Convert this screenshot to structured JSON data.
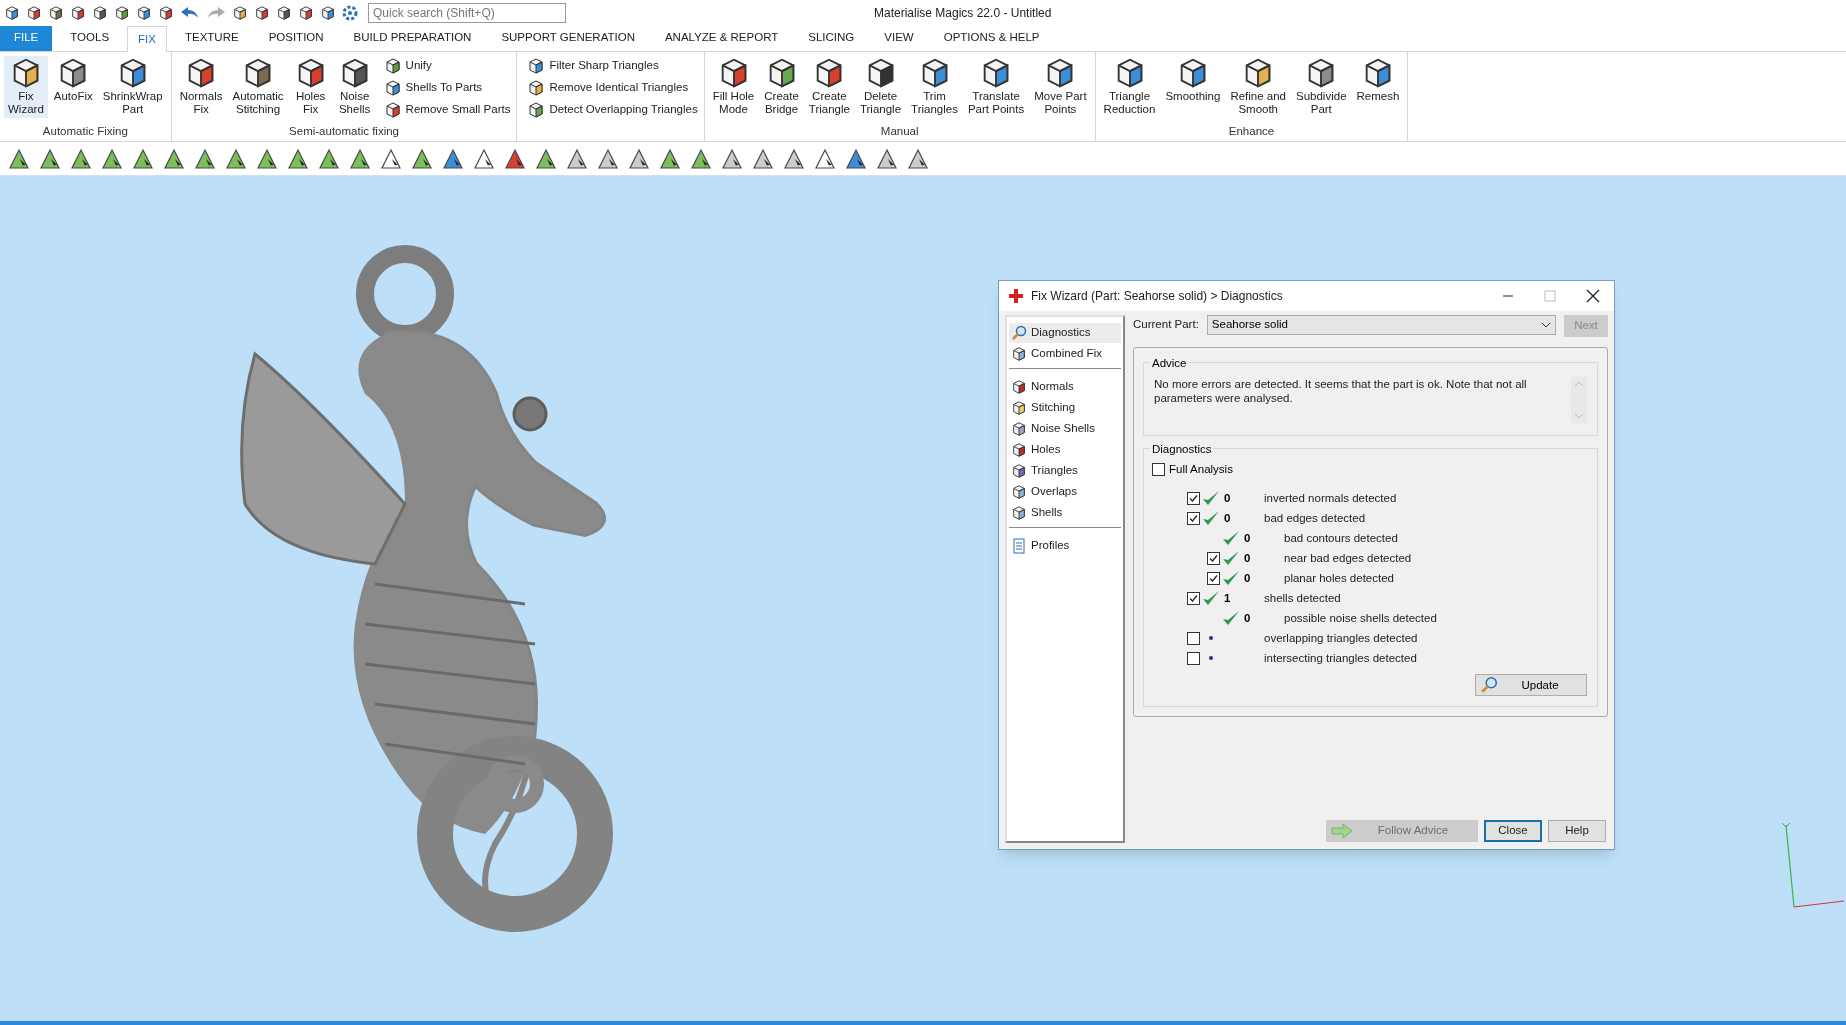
{
  "window": {
    "title": "Materialise Magics 22.0 - Untitled"
  },
  "search": {
    "placeholder": "Quick search (Shift+Q)"
  },
  "tabs": [
    {
      "label": "FILE",
      "kind": "file",
      "selected": false
    },
    {
      "label": "TOOLS",
      "kind": "tab",
      "selected": false
    },
    {
      "label": "FIX",
      "kind": "tab",
      "selected": true
    },
    {
      "label": "TEXTURE",
      "kind": "tab",
      "selected": false
    },
    {
      "label": "POSITION",
      "kind": "tab",
      "selected": false
    },
    {
      "label": "BUILD PREPARATION",
      "kind": "tab",
      "selected": false
    },
    {
      "label": "SUPPORT GENERATION",
      "kind": "tab",
      "selected": false
    },
    {
      "label": "ANALYZE & REPORT",
      "kind": "tab",
      "selected": false
    },
    {
      "label": "SLICING",
      "kind": "tab",
      "selected": false
    },
    {
      "label": "VIEW",
      "kind": "tab",
      "selected": false
    },
    {
      "label": "OPTIONS & HELP",
      "kind": "tab",
      "selected": false
    }
  ],
  "ribbon": {
    "groups": [
      {
        "label": "Automatic Fixing",
        "tools": [
          {
            "label": "Fix\nWizard",
            "kind": "large",
            "selected": true
          },
          {
            "label": "AutoFix",
            "kind": "large",
            "selected": false
          },
          {
            "label": "ShrinkWrap\nPart",
            "kind": "large",
            "selected": false
          }
        ]
      },
      {
        "label": "Semi-automatic fixing",
        "tools": [
          {
            "label": "Normals\nFix",
            "kind": "large",
            "selected": false
          },
          {
            "label": "Automatic\nStitching",
            "kind": "large",
            "selected": false
          },
          {
            "label": "Holes\nFix",
            "kind": "large",
            "selected": false
          },
          {
            "label": "Noise\nShells",
            "kind": "large",
            "selected": false
          },
          {
            "label": "Unify",
            "kind": "small",
            "selected": false
          },
          {
            "label": "Shells To Parts",
            "kind": "small",
            "selected": false
          },
          {
            "label": "Remove Small Parts",
            "kind": "small",
            "selected": false
          }
        ]
      },
      {
        "tools": [
          {
            "label": "Filter Sharp Triangles",
            "kind": "small",
            "selected": false
          },
          {
            "label": "Remove Identical Triangles",
            "kind": "small",
            "selected": false
          },
          {
            "label": "Detect Overlapping Triangles",
            "kind": "small",
            "selected": false
          }
        ]
      },
      {
        "label": "Manual",
        "tools": [
          {
            "label": "Fill Hole\nMode",
            "kind": "large",
            "selected": false
          },
          {
            "label": "Create\nBridge",
            "kind": "large",
            "selected": false
          },
          {
            "label": "Create\nTriangle",
            "kind": "large",
            "selected": false
          },
          {
            "label": "Delete\nTriangle",
            "kind": "large",
            "selected": false
          },
          {
            "label": "Trim\nTriangles",
            "kind": "large",
            "selected": false
          },
          {
            "label": "Translate\nPart Points",
            "kind": "large",
            "selected": false
          },
          {
            "label": "Move Part\nPoints",
            "kind": "large",
            "selected": false
          }
        ]
      },
      {
        "label": "Enhance",
        "tools": [
          {
            "label": "Triangle\nReduction",
            "kind": "large",
            "selected": false
          },
          {
            "label": "Smoothing",
            "kind": "large",
            "selected": false
          },
          {
            "label": "Refine and\nSmooth",
            "kind": "large",
            "selected": false
          },
          {
            "label": "Subdivide\nPart",
            "kind": "large",
            "selected": false
          },
          {
            "label": "Remesh",
            "kind": "large",
            "selected": false
          }
        ]
      }
    ]
  },
  "dialog": {
    "title": "Fix Wizard (Part: Seahorse solid) > Diagnostics",
    "nav_sections": [
      {
        "items": [
          {
            "label": "Diagnostics",
            "selected": true
          },
          {
            "label": "Combined Fix",
            "selected": false
          }
        ]
      },
      {
        "items": [
          {
            "label": "Normals",
            "selected": false
          },
          {
            "label": "Stitching",
            "selected": false
          },
          {
            "label": "Noise Shells",
            "selected": false
          },
          {
            "label": "Holes",
            "selected": false
          },
          {
            "label": "Triangles",
            "selected": false
          },
          {
            "label": "Overlaps",
            "selected": false
          },
          {
            "label": "Shells",
            "selected": false
          }
        ]
      },
      {
        "items": [
          {
            "label": "Profiles",
            "selected": false
          }
        ]
      }
    ],
    "current_part": {
      "label": "Current Part:",
      "value": "Seahorse solid"
    },
    "next_button": {
      "label": "Next",
      "disabled": true
    },
    "advice": {
      "label": "Advice",
      "text": "No more errors are detected. It seems that the part is ok. Note that not all parameters were analysed."
    },
    "diagnostics": {
      "label": "Diagnostics",
      "full_analysis": {
        "label": "Full Analysis",
        "checked": false
      },
      "rows": [
        {
          "kind": "checkbox",
          "checked": true,
          "passed": true,
          "count": "0",
          "label": "inverted normals detected"
        },
        {
          "kind": "checkbox",
          "checked": true,
          "passed": true,
          "count": "0",
          "label": "bad edges detected",
          "children": [
            {
              "kind": "plain",
              "passed": true,
              "count": "0",
              "label": "bad contours detected"
            },
            {
              "kind": "checkbox",
              "checked": true,
              "passed": true,
              "count": "0",
              "label": "near bad edges detected"
            },
            {
              "kind": "checkbox",
              "checked": true,
              "passed": true,
              "count": "0",
              "label": "planar holes detected"
            }
          ]
        },
        {
          "kind": "checkbox",
          "checked": true,
          "passed": true,
          "count": "1",
          "label": "shells detected",
          "children": [
            {
              "kind": "plain",
              "passed": true,
              "count": "0",
              "label": "possible noise shells detected"
            }
          ]
        },
        {
          "kind": "checkbox",
          "checked": false,
          "passed": false,
          "label": "overlapping triangles detected"
        },
        {
          "kind": "checkbox",
          "checked": false,
          "passed": false,
          "label": "intersecting triangles detected"
        }
      ],
      "update_button": "Update"
    },
    "buttons": [
      {
        "label": "Follow Advice",
        "kind": "follow",
        "disabled": true,
        "selected": false
      },
      {
        "label": "Close",
        "kind": "plain",
        "disabled": false,
        "selected": true
      },
      {
        "label": "Help",
        "kind": "plain",
        "disabled": false,
        "selected": false
      }
    ]
  }
}
